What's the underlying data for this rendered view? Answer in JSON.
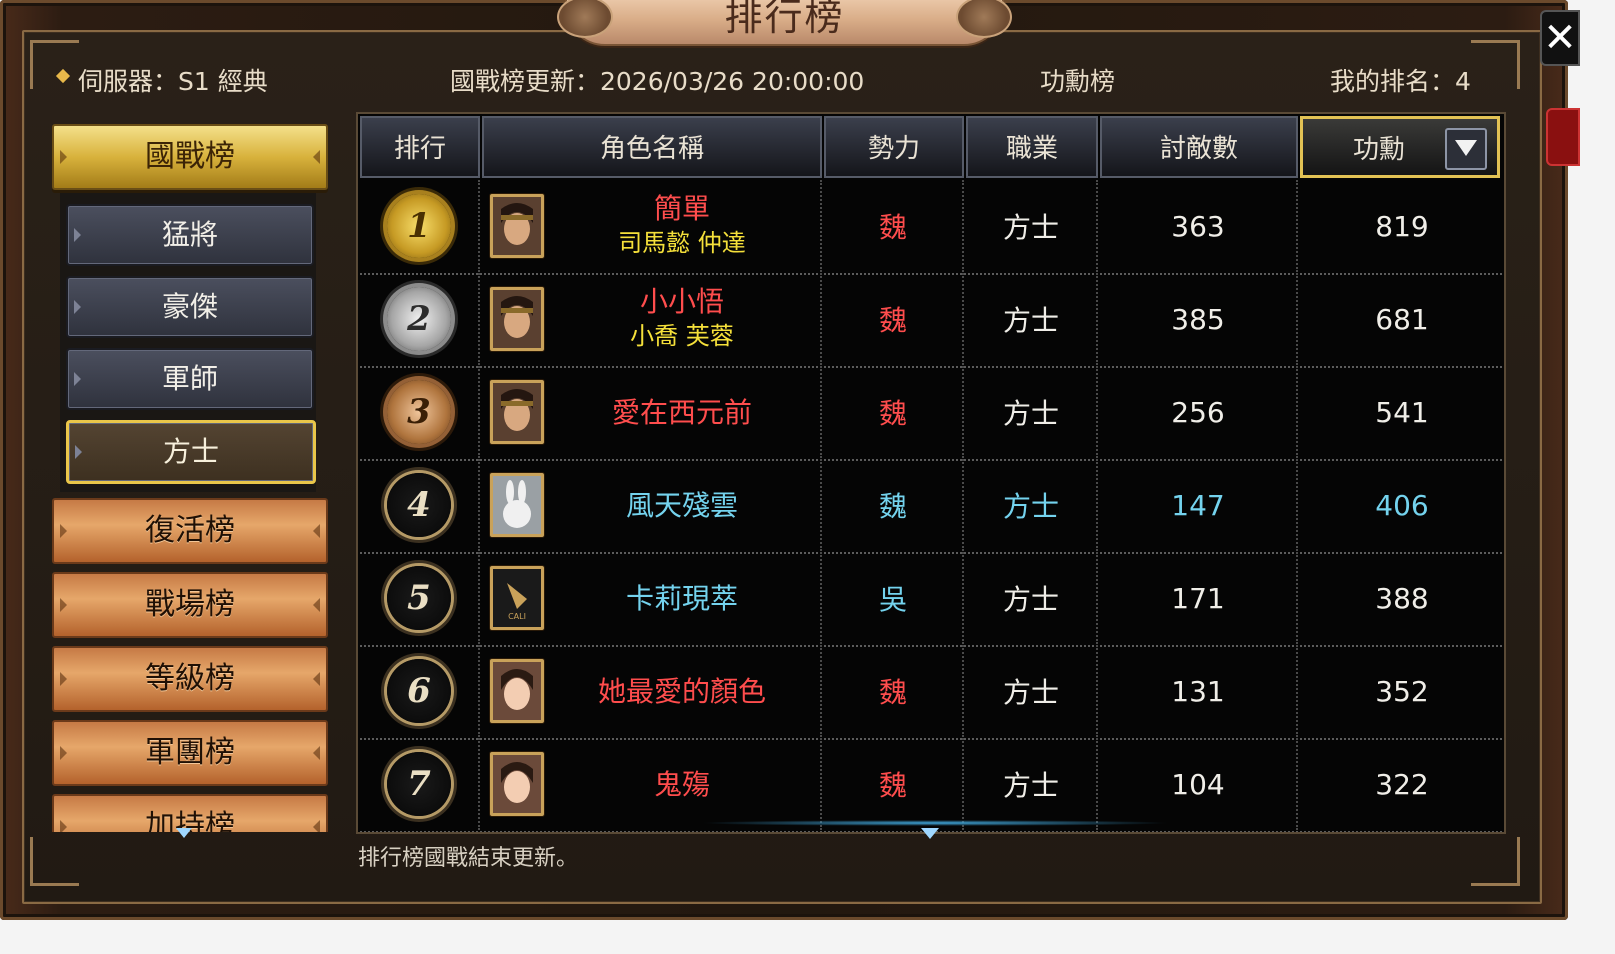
{
  "window": {
    "title": "排行榜",
    "close_label": "✕"
  },
  "header": {
    "server": "伺服器：S1 經典",
    "update": "國戰榜更新：2026/03/26 20:00:00",
    "board_name": "功勳榜",
    "my_rank": "我的排名：4"
  },
  "menu": {
    "main": "國戰榜",
    "subs": [
      "猛將",
      "豪傑",
      "軍師",
      "方士"
    ],
    "active_sub": "方士",
    "others": [
      "復活榜",
      "戰場榜",
      "等級榜",
      "軍團榜",
      "加持榜"
    ]
  },
  "table": {
    "headers": [
      "排行",
      "角色名稱",
      "勢力",
      "職業",
      "討敵數",
      "功勳"
    ],
    "sort_column": "功勳",
    "rows": [
      {
        "rank": "1",
        "name": "簡單",
        "subname": "司馬懿 仲達",
        "faction": "魏",
        "job": "方士",
        "kills": "363",
        "merit": "819",
        "name_color": "#ff4d4d",
        "faction_color": "#ff4d4d",
        "avatar": "warrior-portrait-icon"
      },
      {
        "rank": "2",
        "name": "小小悟",
        "subname": "小喬 芙蓉",
        "faction": "魏",
        "job": "方士",
        "kills": "385",
        "merit": "681",
        "name_color": "#ff4d4d",
        "faction_color": "#ff4d4d",
        "avatar": "warrior-portrait-icon"
      },
      {
        "rank": "3",
        "name": "愛在西元前",
        "subname": "",
        "faction": "魏",
        "job": "方士",
        "kills": "256",
        "merit": "541",
        "name_color": "#ff4d4d",
        "faction_color": "#ff4d4d",
        "avatar": "warrior-portrait-icon"
      },
      {
        "rank": "4",
        "name": "風天殘雲",
        "subname": "",
        "faction": "魏",
        "job": "方士",
        "kills": "147",
        "merit": "406",
        "name_color": "#74d3ee",
        "faction_color": "#74d3ee",
        "avatar": "rabbit-portrait-icon",
        "highlight": true
      },
      {
        "rank": "5",
        "name": "卡莉現萃",
        "subname": "",
        "faction": "吳",
        "job": "方士",
        "kills": "171",
        "merit": "388",
        "name_color": "#74d3ee",
        "faction_color": "#74d3ee",
        "avatar": "emblem-portrait-icon"
      },
      {
        "rank": "6",
        "name": "她最愛的顏色",
        "subname": "",
        "faction": "魏",
        "job": "方士",
        "kills": "131",
        "merit": "352",
        "name_color": "#ff4d4d",
        "faction_color": "#ff4d4d",
        "avatar": "lady-portrait-icon"
      },
      {
        "rank": "7",
        "name": "鬼殤",
        "subname": "",
        "faction": "魏",
        "job": "方士",
        "kills": "104",
        "merit": "322",
        "name_color": "#ff4d4d",
        "faction_color": "#ff4d4d",
        "avatar": "lady-portrait-icon"
      }
    ],
    "subname_color": "#f5e03a",
    "highlight_color": "#74d3ee"
  },
  "footer": {
    "note": "排行榜國戰結束更新。"
  }
}
